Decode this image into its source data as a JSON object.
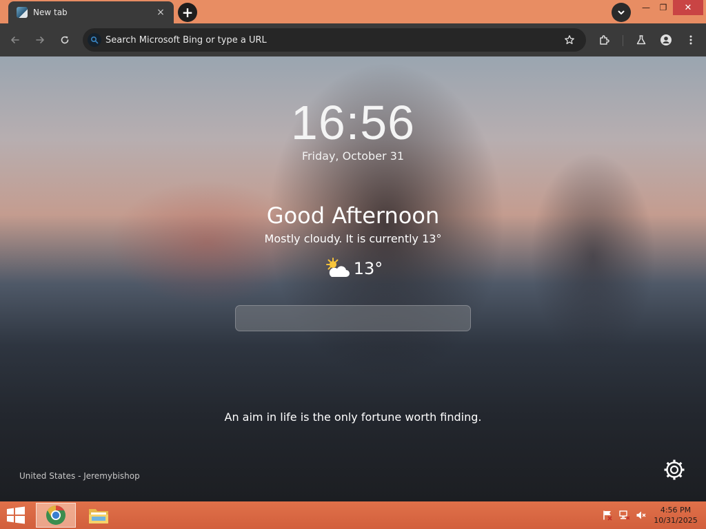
{
  "browser": {
    "tab": {
      "title": "New tab",
      "close_glyph": "×",
      "favicon": "bing-newtab-icon"
    },
    "new_tab_glyph": "+",
    "window_controls": {
      "minimize": "—",
      "restore": "❐",
      "close": "✕"
    },
    "toolbar": {
      "omnibox_placeholder": "Search Microsoft Bing or type a URL",
      "icons": [
        "back-arrow-icon",
        "forward-arrow-icon",
        "reload-icon",
        "bing-search-icon",
        "star-icon",
        "extensions-icon",
        "labs-flask-icon",
        "profile-icon",
        "more-menu-icon"
      ]
    }
  },
  "newtab": {
    "clock": "16:56",
    "date": "Friday, October 31",
    "greeting": "Good Afternoon",
    "weather_description": "Mostly cloudy. It is currently 13°",
    "weather_icon": "partly-cloudy-sun-icon",
    "temperature": "13°",
    "quote": "An aim in life is the only fortune worth finding.",
    "photo_credit": "United States - Jeremybishop",
    "settings_icon": "gear-icon"
  },
  "taskbar": {
    "apps": [
      "windows-start-icon",
      "chrome-browser-icon",
      "file-explorer-icon"
    ],
    "tray_icons": [
      "action-center-flag-icon",
      "network-icon",
      "volume-muted-icon"
    ],
    "time": "4:56 PM",
    "date": "10/31/2025"
  },
  "colors": {
    "titlebar": "#e88d63",
    "toolbar": "#3a3a3a",
    "omnibox": "#262626",
    "taskbar": "#d8653f",
    "close_button": "#c94444"
  }
}
